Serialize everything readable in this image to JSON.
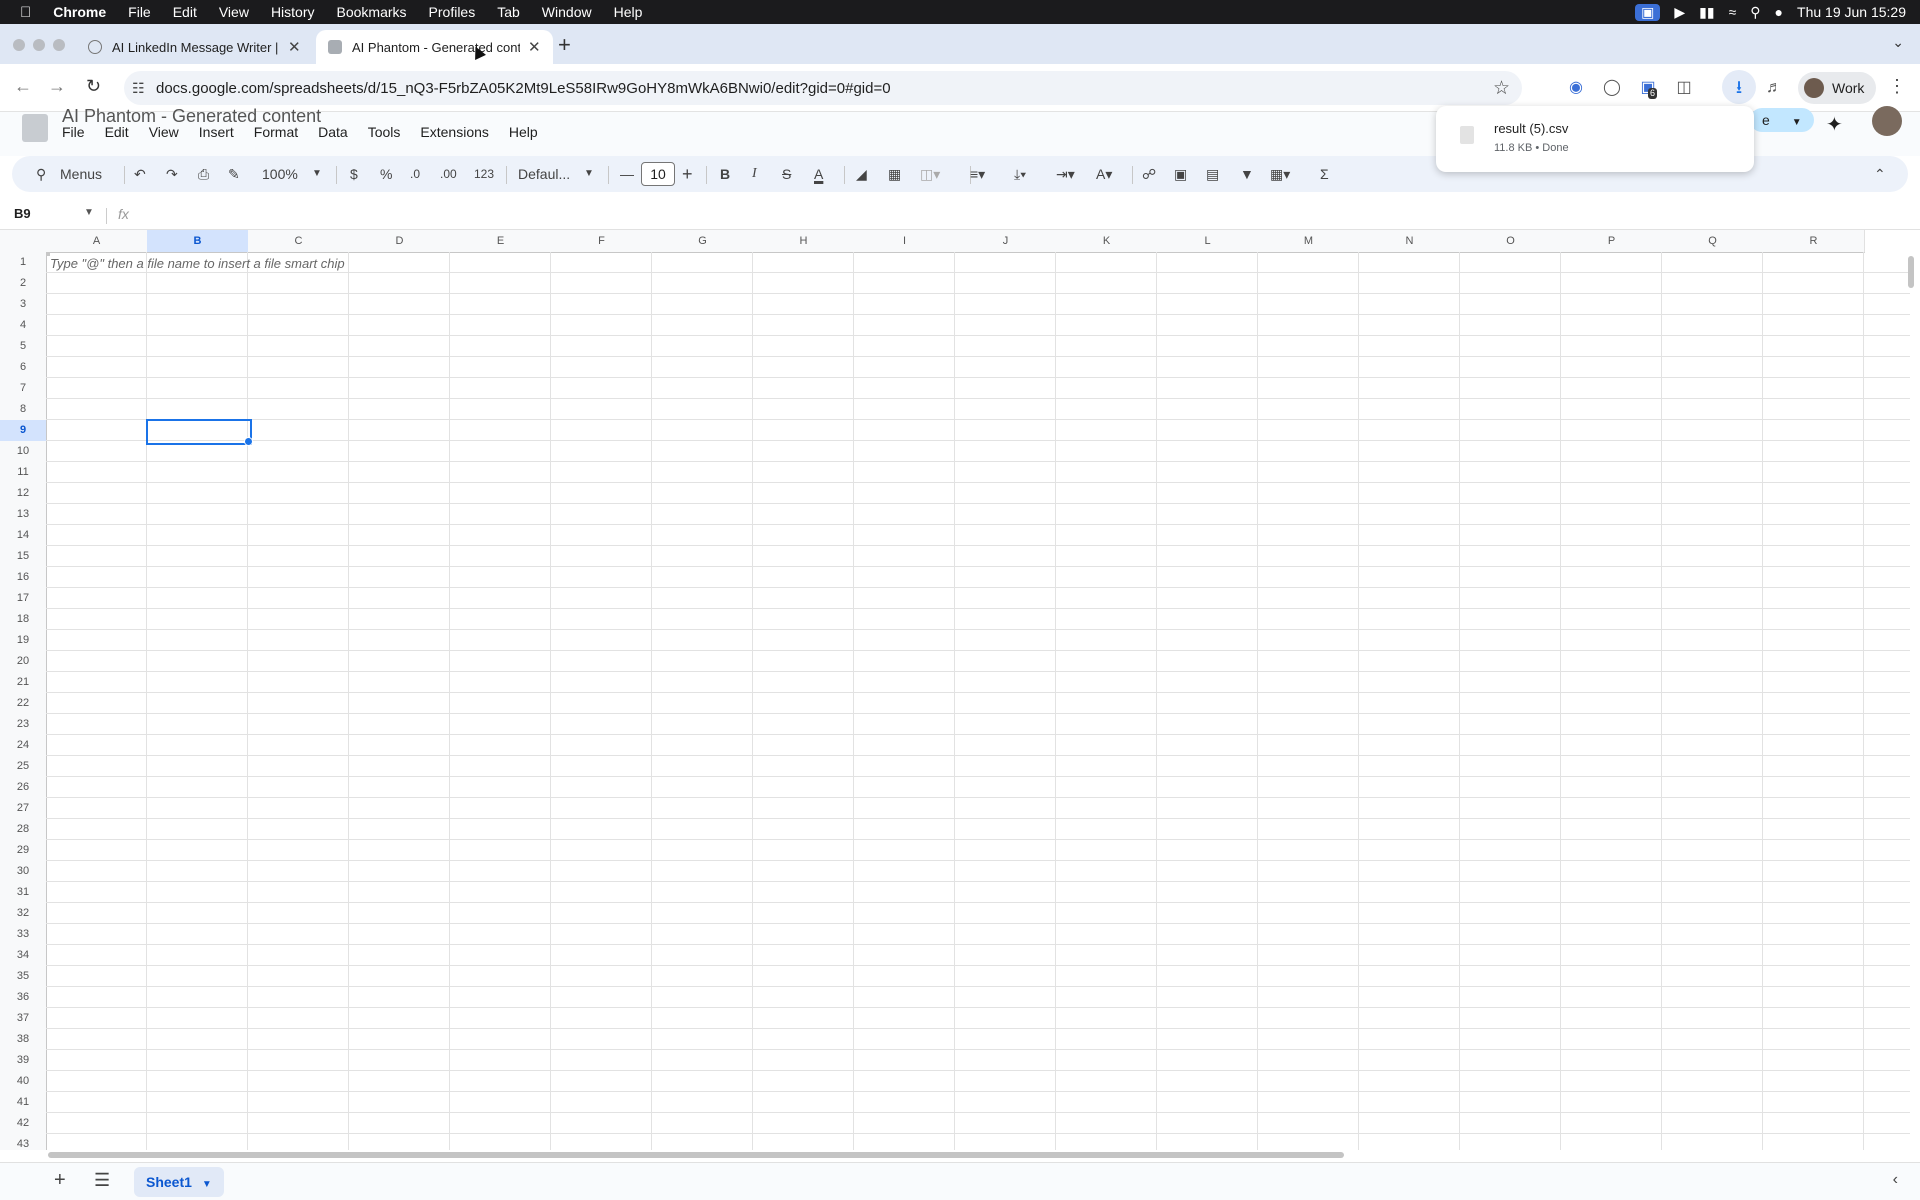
{
  "mac_menu": {
    "app": "Chrome",
    "items": [
      "File",
      "Edit",
      "View",
      "History",
      "Bookmarks",
      "Profiles",
      "Tab",
      "Window",
      "Help"
    ],
    "clock": "Thu 19 Jun  15:29"
  },
  "tabs": [
    {
      "title": "AI LinkedIn Message Writer |",
      "active": false
    },
    {
      "title": "AI Phantom - Generated cont",
      "active": true
    }
  ],
  "address_bar": {
    "url": "docs.google.com/spreadsheets/d/15_nQ3-F5rbZA05K2Mt9LeS58IRw9GoHY8mWkA6BNwi0/edit?gid=0#gid=0"
  },
  "profile": {
    "label": "Work"
  },
  "extensions_badge": "6",
  "download": {
    "name": "result (5).csv",
    "meta": "11.8 KB • Done"
  },
  "sheets": {
    "title": "AI Phantom - Generated content",
    "menus": [
      "File",
      "Edit",
      "View",
      "Insert",
      "Format",
      "Data",
      "Tools",
      "Extensions",
      "Help"
    ],
    "share_fragment": "e",
    "toolbar": {
      "search": "Menus",
      "zoom": "100%",
      "currency": "$",
      "percent": "%",
      "dec_minus": ".0",
      "dec_plus": ".00",
      "number_fmt": "123",
      "font": "Defaul...",
      "font_size": "10"
    },
    "name_box": "B9",
    "fx": "fx",
    "hint": "Type \"@\" then a file name to insert a file smart chip",
    "selected_col": "B",
    "selected_row": 9,
    "columns": [
      "A",
      "B",
      "C",
      "D",
      "E",
      "F",
      "G",
      "H",
      "I",
      "J",
      "K",
      "L",
      "M",
      "N",
      "O",
      "P",
      "Q",
      "R"
    ],
    "row_count": 43,
    "sheet_tab": "Sheet1"
  },
  "colors": {
    "accent": "#1a73e8",
    "tab_strip": "#dfe7f4",
    "toolbar": "#edf2fa",
    "header_selected": "#d3e3fd"
  }
}
